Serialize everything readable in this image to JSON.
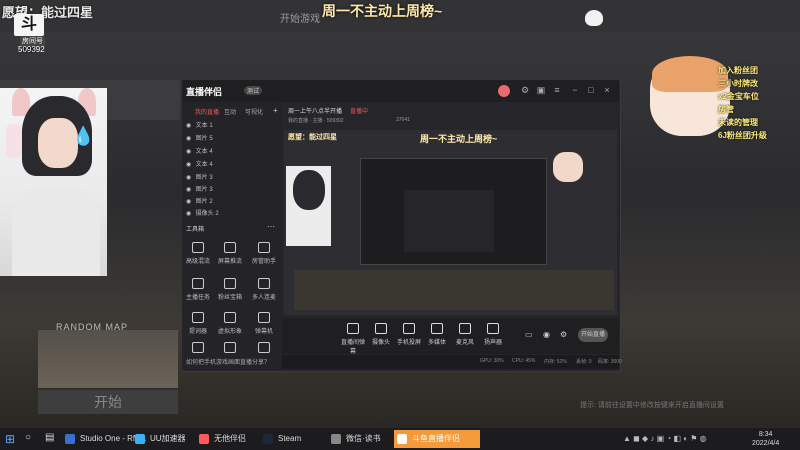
{
  "stream": {
    "watermark": "愿望：能过四星",
    "logo": "斗鱼",
    "room_label": "房间号",
    "room_id": "509392",
    "banner": "周一不主动上周榜~",
    "game_top": "开始游戏"
  },
  "sticker_lines": [
    "加入粉丝团",
    "三小时牌改",
    "x2金宝车位",
    "房管",
    "未读的管理",
    "6J粉丝团升级"
  ],
  "random_map": "RANDOM MAP",
  "start_button": "开始",
  "app": {
    "logo": "直播伴侣",
    "badge": "测试",
    "tabs": [
      "我的直播",
      "互动",
      "可视化"
    ],
    "layers": [
      "文本 1",
      "图片 5",
      "文本 4",
      "文本 4",
      "图片 3",
      "图片 3",
      "图片 2",
      "摄像头 2"
    ],
    "tools_title": "工具箱",
    "tools": [
      "高级混流",
      "屏幕推流",
      "房管助手",
      "主播任务",
      "粉丝宝箱",
      "多人连麦",
      "提词器",
      "虚拟形象",
      "弹幕机",
      "",
      "",
      ""
    ],
    "bottom_tip": "如何把手机游戏画面直播分享？",
    "preview_title": "周一上午八点半开播",
    "preview_live": "直播中",
    "preview_sub": "我的直播 · 主播 · 509392",
    "preview_count": "37041",
    "toolbar": [
      "直播间弹幕",
      "摄像头",
      "手机投屏",
      "多媒体",
      "麦克风",
      "扬声器"
    ],
    "start_live": "开始直播",
    "status": [
      "GPU: 30%",
      "CPU: 45%",
      "内存: 52%",
      "丢帧: 0",
      "码率: 3000"
    ]
  },
  "taskbar": {
    "apps": [
      "Studio One - RM...",
      "UU加速器",
      "无他伴侣",
      "Steam",
      "微信·读书",
      "斗鱼直播伴侣"
    ],
    "time": "8:34",
    "date": "2022/4/4"
  },
  "hint_right": "提示: 请前往设置中修改按键来开启直播间设置",
  "colors": {
    "accent": "#e85a5a",
    "banner": "#ffe9a8",
    "sticker": "#ffec7a"
  }
}
